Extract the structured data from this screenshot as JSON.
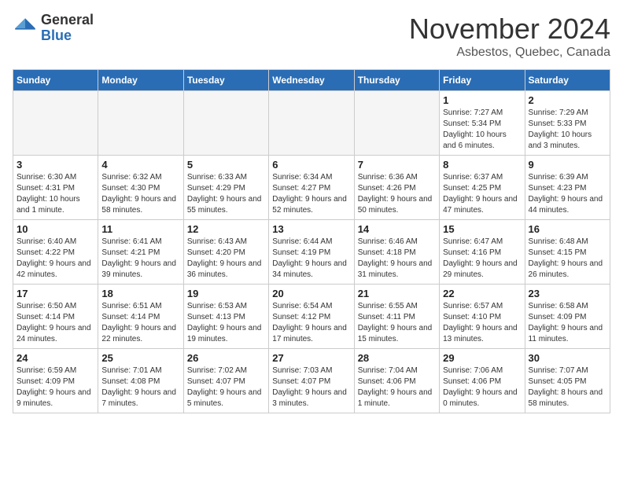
{
  "logo": {
    "general": "General",
    "blue": "Blue"
  },
  "title": "November 2024",
  "location": "Asbestos, Quebec, Canada",
  "weekdays": [
    "Sunday",
    "Monday",
    "Tuesday",
    "Wednesday",
    "Thursday",
    "Friday",
    "Saturday"
  ],
  "weeks": [
    [
      {
        "day": "",
        "info": ""
      },
      {
        "day": "",
        "info": ""
      },
      {
        "day": "",
        "info": ""
      },
      {
        "day": "",
        "info": ""
      },
      {
        "day": "",
        "info": ""
      },
      {
        "day": "1",
        "info": "Sunrise: 7:27 AM\nSunset: 5:34 PM\nDaylight: 10 hours and 6 minutes."
      },
      {
        "day": "2",
        "info": "Sunrise: 7:29 AM\nSunset: 5:33 PM\nDaylight: 10 hours and 3 minutes."
      }
    ],
    [
      {
        "day": "3",
        "info": "Sunrise: 6:30 AM\nSunset: 4:31 PM\nDaylight: 10 hours and 1 minute."
      },
      {
        "day": "4",
        "info": "Sunrise: 6:32 AM\nSunset: 4:30 PM\nDaylight: 9 hours and 58 minutes."
      },
      {
        "day": "5",
        "info": "Sunrise: 6:33 AM\nSunset: 4:29 PM\nDaylight: 9 hours and 55 minutes."
      },
      {
        "day": "6",
        "info": "Sunrise: 6:34 AM\nSunset: 4:27 PM\nDaylight: 9 hours and 52 minutes."
      },
      {
        "day": "7",
        "info": "Sunrise: 6:36 AM\nSunset: 4:26 PM\nDaylight: 9 hours and 50 minutes."
      },
      {
        "day": "8",
        "info": "Sunrise: 6:37 AM\nSunset: 4:25 PM\nDaylight: 9 hours and 47 minutes."
      },
      {
        "day": "9",
        "info": "Sunrise: 6:39 AM\nSunset: 4:23 PM\nDaylight: 9 hours and 44 minutes."
      }
    ],
    [
      {
        "day": "10",
        "info": "Sunrise: 6:40 AM\nSunset: 4:22 PM\nDaylight: 9 hours and 42 minutes."
      },
      {
        "day": "11",
        "info": "Sunrise: 6:41 AM\nSunset: 4:21 PM\nDaylight: 9 hours and 39 minutes."
      },
      {
        "day": "12",
        "info": "Sunrise: 6:43 AM\nSunset: 4:20 PM\nDaylight: 9 hours and 36 minutes."
      },
      {
        "day": "13",
        "info": "Sunrise: 6:44 AM\nSunset: 4:19 PM\nDaylight: 9 hours and 34 minutes."
      },
      {
        "day": "14",
        "info": "Sunrise: 6:46 AM\nSunset: 4:18 PM\nDaylight: 9 hours and 31 minutes."
      },
      {
        "day": "15",
        "info": "Sunrise: 6:47 AM\nSunset: 4:16 PM\nDaylight: 9 hours and 29 minutes."
      },
      {
        "day": "16",
        "info": "Sunrise: 6:48 AM\nSunset: 4:15 PM\nDaylight: 9 hours and 26 minutes."
      }
    ],
    [
      {
        "day": "17",
        "info": "Sunrise: 6:50 AM\nSunset: 4:14 PM\nDaylight: 9 hours and 24 minutes."
      },
      {
        "day": "18",
        "info": "Sunrise: 6:51 AM\nSunset: 4:14 PM\nDaylight: 9 hours and 22 minutes."
      },
      {
        "day": "19",
        "info": "Sunrise: 6:53 AM\nSunset: 4:13 PM\nDaylight: 9 hours and 19 minutes."
      },
      {
        "day": "20",
        "info": "Sunrise: 6:54 AM\nSunset: 4:12 PM\nDaylight: 9 hours and 17 minutes."
      },
      {
        "day": "21",
        "info": "Sunrise: 6:55 AM\nSunset: 4:11 PM\nDaylight: 9 hours and 15 minutes."
      },
      {
        "day": "22",
        "info": "Sunrise: 6:57 AM\nSunset: 4:10 PM\nDaylight: 9 hours and 13 minutes."
      },
      {
        "day": "23",
        "info": "Sunrise: 6:58 AM\nSunset: 4:09 PM\nDaylight: 9 hours and 11 minutes."
      }
    ],
    [
      {
        "day": "24",
        "info": "Sunrise: 6:59 AM\nSunset: 4:09 PM\nDaylight: 9 hours and 9 minutes."
      },
      {
        "day": "25",
        "info": "Sunrise: 7:01 AM\nSunset: 4:08 PM\nDaylight: 9 hours and 7 minutes."
      },
      {
        "day": "26",
        "info": "Sunrise: 7:02 AM\nSunset: 4:07 PM\nDaylight: 9 hours and 5 minutes."
      },
      {
        "day": "27",
        "info": "Sunrise: 7:03 AM\nSunset: 4:07 PM\nDaylight: 9 hours and 3 minutes."
      },
      {
        "day": "28",
        "info": "Sunrise: 7:04 AM\nSunset: 4:06 PM\nDaylight: 9 hours and 1 minute."
      },
      {
        "day": "29",
        "info": "Sunrise: 7:06 AM\nSunset: 4:06 PM\nDaylight: 9 hours and 0 minutes."
      },
      {
        "day": "30",
        "info": "Sunrise: 7:07 AM\nSunset: 4:05 PM\nDaylight: 8 hours and 58 minutes."
      }
    ]
  ]
}
